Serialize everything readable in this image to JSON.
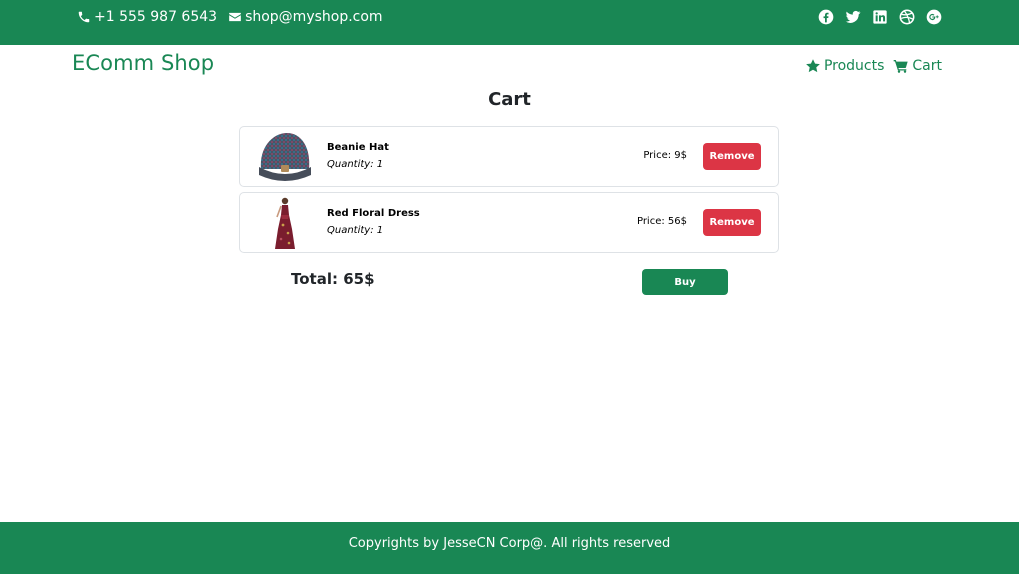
{
  "topbar": {
    "phone": "+1 555 987 6543",
    "email": "shop@myshop.com",
    "social_icons": [
      "facebook-icon",
      "twitter-icon",
      "linkedin-icon",
      "dribbble-icon",
      "google-plus-icon"
    ]
  },
  "navbar": {
    "brand": "EComm Shop",
    "links": [
      {
        "label": "Products",
        "icon": "star-icon"
      },
      {
        "label": "Cart",
        "icon": "cart-icon"
      }
    ]
  },
  "page": {
    "title": "Cart"
  },
  "cart": {
    "items": [
      {
        "name": "Beanie Hat",
        "quantity": "Quantity: 1",
        "price": "Price: 9$",
        "remove_label": "Remove"
      },
      {
        "name": "Red Floral Dress",
        "quantity": "Quantity: 1",
        "price": "Price: 56$",
        "remove_label": "Remove"
      }
    ],
    "total": "Total: 65$",
    "buy_label": "Buy"
  },
  "footer": {
    "text": "Copyrights by JesseCN Corp@. All rights reserved"
  },
  "colors": {
    "brand_green": "#198754",
    "danger_red": "#dc3545"
  }
}
